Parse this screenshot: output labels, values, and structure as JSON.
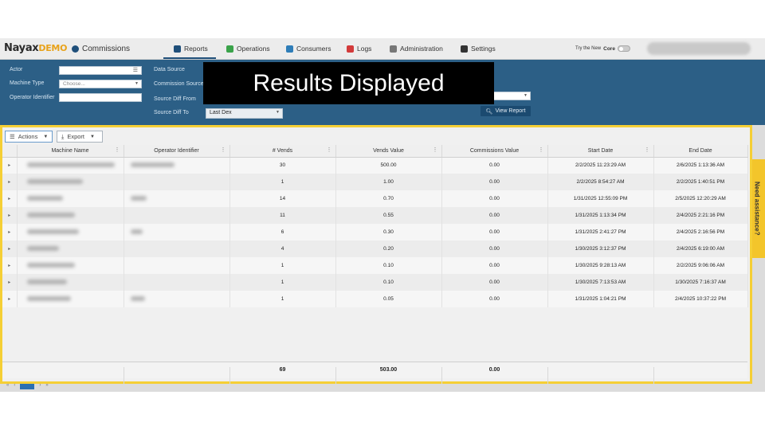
{
  "nav": {
    "logo": "Nayax",
    "logo_suffix": "DEMO",
    "app_name": "Commissions",
    "items": [
      {
        "label": "Reports",
        "color": "#1f4f7a"
      },
      {
        "label": "Operations",
        "color": "#3aa34a"
      },
      {
        "label": "Consumers",
        "color": "#2e7db8"
      },
      {
        "label": "Logs",
        "color": "#d23a3a"
      },
      {
        "label": "Administration",
        "color": "#777777"
      },
      {
        "label": "Settings",
        "color": "#333333"
      }
    ],
    "try_core_prefix": "Try the New",
    "try_core_brand": "Core"
  },
  "filters": {
    "actor_label": "Actor",
    "machine_type_label": "Machine Type",
    "machine_type_placeholder": "Choose...",
    "operator_identifier_label": "Operator Identifier",
    "data_source_label": "Data Source",
    "commission_source_label": "Commission Source",
    "source_diff_from_label": "Source Diff From",
    "source_diff_to_label": "Source Diff To",
    "source_diff_to_value": "Last Dex",
    "view_report_label": "View Report"
  },
  "overlay": {
    "title": "Results Displayed"
  },
  "toolbar": {
    "actions_label": "Actions",
    "export_label": "Export"
  },
  "grid": {
    "columns": [
      "Machine Name",
      "Operator Identifier",
      "# Vends",
      "Vends Value",
      "Commissions Value",
      "Start Date",
      "End Date"
    ],
    "rows": [
      {
        "vends": "30",
        "vends_value": "500.00",
        "commissions": "0.00",
        "start": "2/2/2025 11:23:29 AM",
        "end": "2/6/2025 1:13:36 AM"
      },
      {
        "vends": "1",
        "vends_value": "1.00",
        "commissions": "0.00",
        "start": "2/2/2025 8:54:27 AM",
        "end": "2/2/2025 1:40:51 PM"
      },
      {
        "vends": "14",
        "vends_value": "0.70",
        "commissions": "0.00",
        "start": "1/31/2025 12:55:09 PM",
        "end": "2/5/2025 12:20:29 AM"
      },
      {
        "vends": "11",
        "vends_value": "0.55",
        "commissions": "0.00",
        "start": "1/31/2025 1:13:34 PM",
        "end": "2/4/2025 2:21:16 PM"
      },
      {
        "vends": "6",
        "vends_value": "0.30",
        "commissions": "0.00",
        "start": "1/31/2025 2:41:27 PM",
        "end": "2/4/2025 2:16:56 PM"
      },
      {
        "vends": "4",
        "vends_value": "0.20",
        "commissions": "0.00",
        "start": "1/30/2025 3:12:37 PM",
        "end": "2/4/2025 6:19:00 AM"
      },
      {
        "vends": "1",
        "vends_value": "0.10",
        "commissions": "0.00",
        "start": "1/30/2025 9:28:13 AM",
        "end": "2/2/2025 9:06:06 AM"
      },
      {
        "vends": "1",
        "vends_value": "0.10",
        "commissions": "0.00",
        "start": "1/30/2025 7:13:53 AM",
        "end": "1/30/2025 7:16:37 AM"
      },
      {
        "vends": "1",
        "vends_value": "0.05",
        "commissions": "0.00",
        "start": "1/31/2025 1:04:21 PM",
        "end": "2/4/2025 10:37:22 PM"
      }
    ],
    "totals": {
      "vends": "69",
      "vends_value": "503.00",
      "commissions": "0.00"
    }
  },
  "assist_tab": "Need assistance?",
  "colors": {
    "panel": "#2c5f86",
    "highlight": "#f5cf35",
    "overlay": "#000000"
  }
}
